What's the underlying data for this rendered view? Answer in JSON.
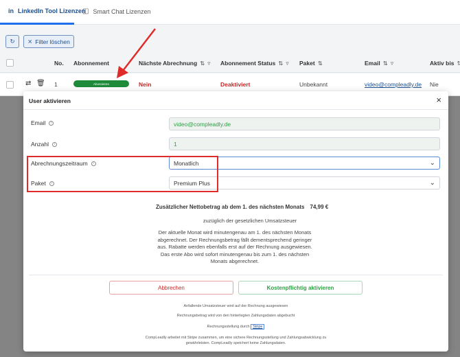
{
  "tabs": [
    {
      "label": "LinkedIn Tool Lizenzen",
      "icon": "linkedin-icon",
      "active": true
    },
    {
      "label": "Smart Chat Lizenzen",
      "icon": "chat-icon",
      "active": false
    }
  ],
  "toolbar": {
    "refresh_icon": "refresh-icon",
    "filter_label": "Filter löschen"
  },
  "table": {
    "columns": [
      {
        "label": "No.",
        "sortable": false,
        "filterable": false
      },
      {
        "label": "Abonnement",
        "sortable": false,
        "filterable": false
      },
      {
        "label": "Nächste Abrechnung",
        "sortable": true,
        "filterable": true
      },
      {
        "label": "Abonnement Status",
        "sortable": true,
        "filterable": true
      },
      {
        "label": "Paket",
        "sortable": true,
        "filterable": false
      },
      {
        "label": "Email",
        "sortable": true,
        "filterable": true
      },
      {
        "label": "Aktiv bis",
        "sortable": true,
        "filterable": false
      }
    ],
    "rows": [
      {
        "no": "1",
        "abonnement": "Abonnieren",
        "naechste_abrechnung": "Nein",
        "status": "Deaktiviert",
        "paket": "Unbekannt",
        "email": "video@compleadly.de",
        "aktiv_bis": "Nie"
      }
    ]
  },
  "modal": {
    "title": "User aktivieren",
    "fields": {
      "email": {
        "label": "Email",
        "value": "video@compleadly.de"
      },
      "anzahl": {
        "label": "Anzahl",
        "value": "1"
      },
      "abrechnungszeitraum": {
        "label": "Abrechnungszeitraum",
        "value": "Monatlich"
      },
      "paket": {
        "label": "Paket",
        "value": "Premium Plus"
      }
    },
    "net_amount_label": "Zusätzlicher Nettobetrag ab dem 1. des nächsten Monats",
    "net_amount_value": "74,99 €",
    "tax_note": "zuzüglich der gesetzlichen Umsatzsteuer",
    "billing_info": "Der aktuelle Monat wird minutengenau am 1. des nächsten Monats abgerechnet. Der Rechnungsbetrag fällt dementsprechend geringer aus. Rabatte werden ebenfalls erst auf der Rechnung ausgewiesen. Das erste Abo wird sofort minutengenau bis zum 1. des nächsten Monats abgerechnet.",
    "cancel_label": "Abbrechen",
    "confirm_label": "Kostenpflichtig aktivieren",
    "note_tax": "Anfallende Umsatzsteuer wird auf der Rechnung ausgewiesen",
    "note_payment": "Rechnungsbetrag wird von den hinterlegten Zahlungsdaten abgebucht",
    "note_billing_prefix": "Rechnungsstellung durch",
    "note_billing_link": "Stripe",
    "footer_note": "CompLeadly arbeitet mit Stripe zusammen, um eine sichere Rechnungsstellung und Zahlungsabwicklung zu gewährleisten. CompLeadly speichert keine Zahlungsdaten."
  },
  "colors": {
    "accent": "#1f6feb",
    "success": "#2f9e44",
    "danger": "#c62828",
    "annotation": "#e02b2b"
  }
}
